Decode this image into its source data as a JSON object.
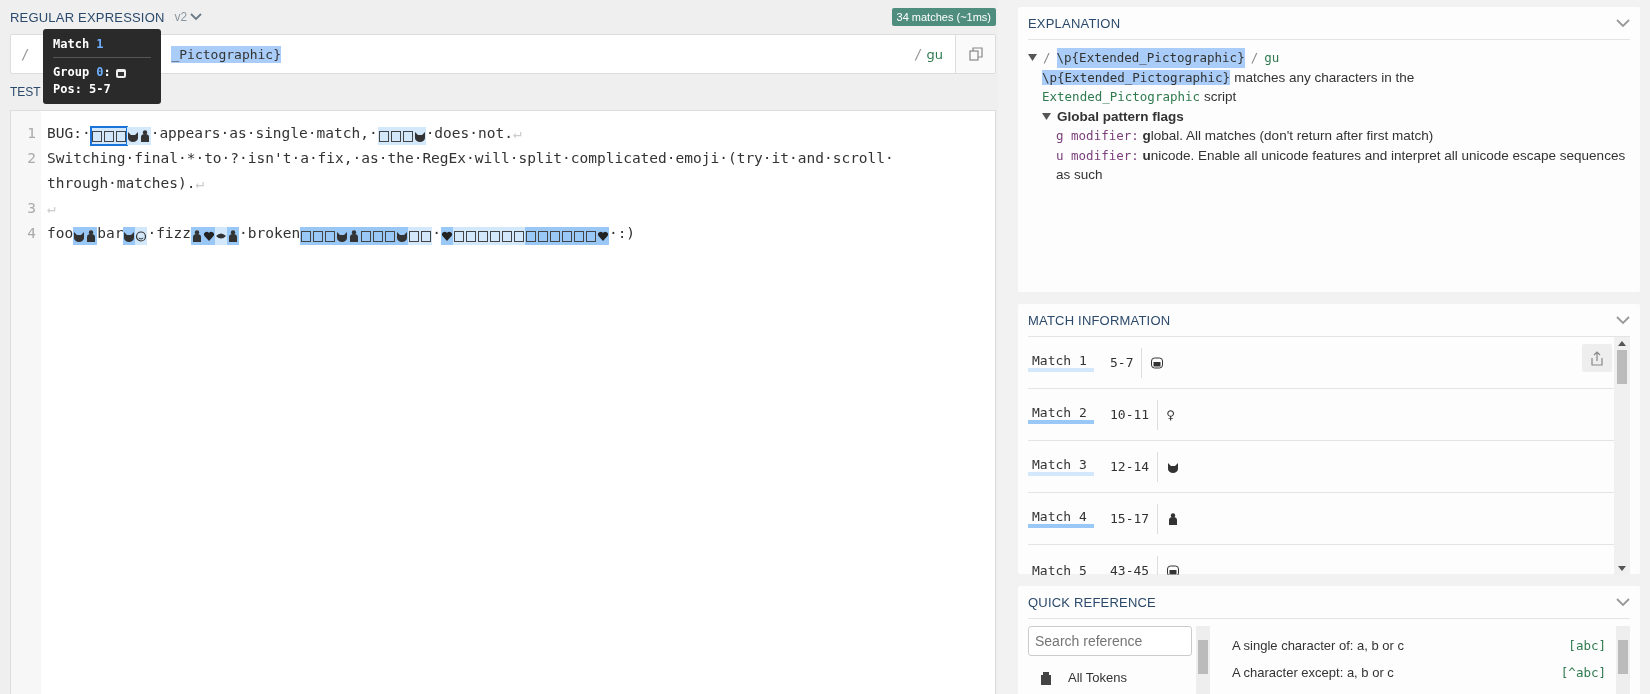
{
  "regex_panel": {
    "title": "REGULAR EXPRESSION",
    "version": "v2",
    "match_badge": "34 matches (~1ms)",
    "delimiter_open": "/",
    "pattern_visible": "_Pictographic}",
    "delimiter_close": "/",
    "flags": "gu"
  },
  "tooltip": {
    "title": "Match",
    "match_number": "1",
    "group_label": "Group",
    "group_number": "0",
    "group_suffix": ":",
    "pos": "Pos: 5-7"
  },
  "test_panel": {
    "label": "TEST",
    "lines": [
      {
        "number": "1",
        "segments": [
          {
            "kind": "text",
            "text": "BUG:·"
          },
          {
            "kind": "emoji",
            "icons": [
              {
                "kind": "box"
              },
              {
                "kind": "box"
              },
              {
                "kind": "box"
              }
            ],
            "color": "#d4e8fb",
            "selected": true
          },
          {
            "kind": "emoji",
            "icons": [
              {
                "kind": "cat"
              },
              {
                "kind": "person"
              }
            ],
            "color": "#d4e8fb",
            "selected": false
          },
          {
            "kind": "text",
            "text": "·appears·as·single·match,·"
          },
          {
            "kind": "emoji",
            "icons": [
              {
                "kind": "box"
              },
              {
                "kind": "box"
              },
              {
                "kind": "box"
              },
              {
                "kind": "cat"
              }
            ],
            "color": "#d4e8fb",
            "selected": false
          },
          {
            "kind": "text",
            "text": "·does·not."
          },
          {
            "kind": "eol",
            "text": "↵"
          }
        ]
      },
      {
        "number": "2",
        "segments": [
          {
            "kind": "text",
            "text": "Switching·final·*·to·?·isn't·a·fix,·as·the·RegEx·will·split·complicated·emoji·(try·it·and·scroll·"
          },
          {
            "kind": "text",
            "text": "through·matches)."
          },
          {
            "kind": "eol",
            "text": "↵"
          }
        ]
      },
      {
        "number": "3",
        "segments": [
          {
            "kind": "eol",
            "text": "↵"
          }
        ]
      },
      {
        "number": "4",
        "segments": [
          {
            "kind": "text",
            "text": "foo"
          },
          {
            "kind": "emoji",
            "icons": [
              {
                "kind": "cat"
              },
              {
                "kind": "person"
              }
            ],
            "color": "#99c8f7",
            "selected": false
          },
          {
            "kind": "text",
            "text": "bar"
          },
          {
            "kind": "emoji",
            "icons": [
              {
                "kind": "cat"
              }
            ],
            "color": "#99c8f7",
            "selected": false
          },
          {
            "kind": "emoji",
            "icons": [
              {
                "kind": "smile"
              }
            ],
            "color": "#d4e8fb",
            "selected": false
          },
          {
            "kind": "text",
            "text": "·fizz"
          },
          {
            "kind": "emoji",
            "icons": [
              {
                "kind": "person"
              },
              {
                "kind": "heart"
              }
            ],
            "color": "#99c8f7",
            "selected": false
          },
          {
            "kind": "emoji",
            "icons": [
              {
                "kind": "lips"
              }
            ],
            "color": "#d4e8fb",
            "selected": false
          },
          {
            "kind": "emoji",
            "icons": [
              {
                "kind": "person"
              }
            ],
            "color": "#99c8f7",
            "selected": false
          },
          {
            "kind": "text",
            "text": "·broken"
          },
          {
            "kind": "emoji",
            "icons": [
              {
                "kind": "box"
              },
              {
                "kind": "box"
              },
              {
                "kind": "box"
              },
              {
                "kind": "cat"
              },
              {
                "kind": "person"
              },
              {
                "kind": "box"
              },
              {
                "kind": "box"
              },
              {
                "kind": "box"
              },
              {
                "kind": "cat"
              }
            ],
            "color": "#99c8f7",
            "selected": false
          },
          {
            "kind": "emoji",
            "icons": [
              {
                "kind": "box"
              },
              {
                "kind": "box"
              }
            ],
            "color": "#d4e8fb",
            "selected": false
          },
          {
            "kind": "text",
            "text": "·"
          },
          {
            "kind": "emoji",
            "icons": [
              {
                "kind": "heart"
              }
            ],
            "color": "#99c8f7",
            "selected": false
          },
          {
            "kind": "emoji",
            "icons": [
              {
                "kind": "box"
              },
              {
                "kind": "box"
              },
              {
                "kind": "box"
              },
              {
                "kind": "box"
              },
              {
                "kind": "box"
              },
              {
                "kind": "box"
              }
            ],
            "color": "#d4e8fb",
            "selected": false
          },
          {
            "kind": "emoji",
            "icons": [
              {
                "kind": "box"
              },
              {
                "kind": "box"
              },
              {
                "kind": "box"
              },
              {
                "kind": "box"
              },
              {
                "kind": "box"
              },
              {
                "kind": "box"
              },
              {
                "kind": "heart"
              }
            ],
            "color": "#99c8f7",
            "selected": false
          },
          {
            "kind": "text",
            "text": "·:)"
          }
        ]
      }
    ]
  },
  "explanation": {
    "title": "EXPLANATION",
    "expanded": true,
    "delimiter_open": "/",
    "pattern": "\\p{Extended_Pictographic}",
    "delimiter_close": "/",
    "flags": "gu",
    "token": "\\p{Extended_Pictographic}",
    "token_desc": "matches any characters in the",
    "script_name": "Extended_Pictographic",
    "script_word": "script",
    "flags_heading": "Global pattern flags",
    "flags_expanded": true,
    "flag_items": [
      {
        "code": "g modifier:",
        "initial": "g",
        "rest": "lobal. All matches (don't return after first match)"
      },
      {
        "code": "u modifier:",
        "initial": "u",
        "rest": "nicode. Enable all unicode features and interpret all unicode escape sequences as such"
      }
    ]
  },
  "match_info": {
    "title": "MATCH INFORMATION",
    "matches": [
      {
        "label": "Match 1",
        "range": "5-7",
        "color": "#d4e8fb",
        "kind": "hands"
      },
      {
        "label": "Match 2",
        "range": "10-11",
        "color": "#99c8f7",
        "kind": "char",
        "char": "♀"
      },
      {
        "label": "Match 3",
        "range": "12-14",
        "color": "#d4e8fb",
        "kind": "cat"
      },
      {
        "label": "Match 4",
        "range": "15-17",
        "color": "#99c8f7",
        "kind": "person"
      },
      {
        "label": "Match 5",
        "range": "43-45",
        "kind": "hands"
      }
    ]
  },
  "quick_reference": {
    "title": "QUICK REFERENCE",
    "search": {
      "placeholder": "Search reference"
    },
    "categories": [
      {
        "label": "All Tokens"
      }
    ],
    "entries": [
      {
        "description": "A single character of: a, b or c",
        "token": "[abc]"
      },
      {
        "description": "A character except: a, b or c",
        "token": "[^abc]"
      }
    ]
  }
}
